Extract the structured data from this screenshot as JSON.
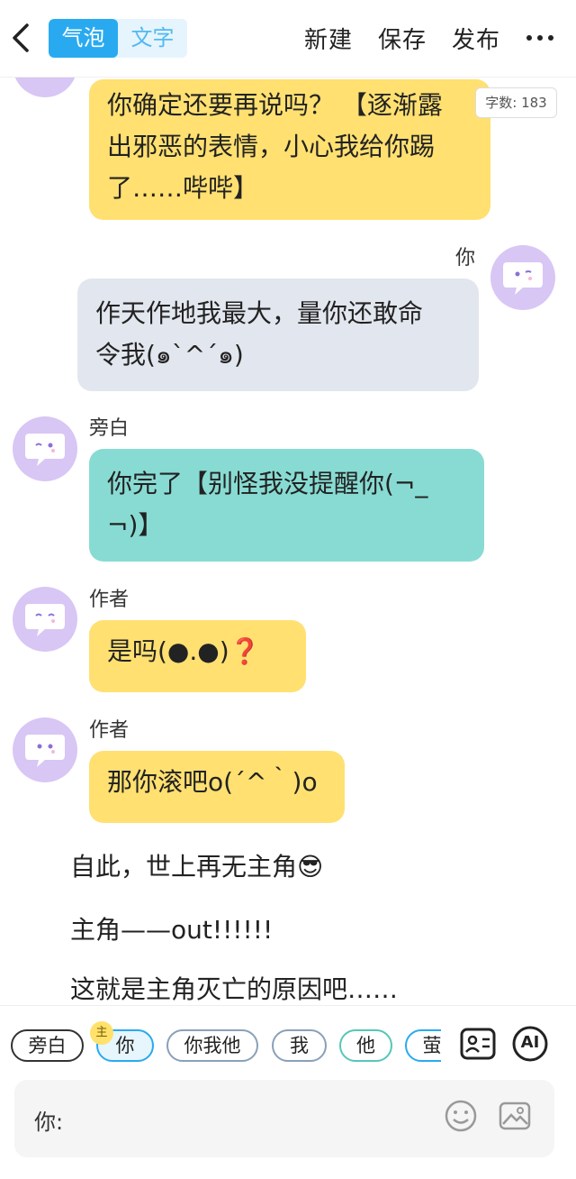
{
  "header": {
    "tab_bubble": "气泡",
    "tab_text": "文字",
    "new_label": "新建",
    "save_label": "保存",
    "publish_label": "发布"
  },
  "word_count": "字数: 183",
  "messages": [
    {
      "speaker": "",
      "text_lines": [
        "你确定还要再说吗？ 【逐渐露",
        "出邪恶的表情，小心我给你踢",
        "了……哔哔】"
      ],
      "color": "#ffe071"
    },
    {
      "speaker": "你",
      "text_lines": [
        "作天作地我最大，量你还敢命",
        "令我(๑`^´๑)"
      ],
      "color": "#e2e6ee"
    },
    {
      "speaker": "旁白",
      "text_lines": [
        "你完了【别怪我没提醒你(¬_",
        "¬)】"
      ],
      "color": "#88dbd3"
    },
    {
      "speaker": "作者",
      "text_lines": [
        "是吗(●.●)❓"
      ],
      "color": "#ffe071"
    },
    {
      "speaker": "作者",
      "text_lines": [
        "那你滚吧o(´^｀)o"
      ],
      "color": "#ffe071"
    }
  ],
  "narration": [
    "自此，世上再无主角😎",
    "主角——out!!!!!!",
    "这就是主角灭亡的原因吧……"
  ],
  "roles": [
    "旁白",
    "你",
    "你我他",
    "我",
    "他",
    "萤"
  ],
  "role_badge": "主",
  "selected_role": "你",
  "input": {
    "label": "你:"
  },
  "tools": {
    "ai_label": "AI"
  },
  "colors": {
    "accent": "#29aaf0",
    "avatar": "#d8c6f5"
  }
}
